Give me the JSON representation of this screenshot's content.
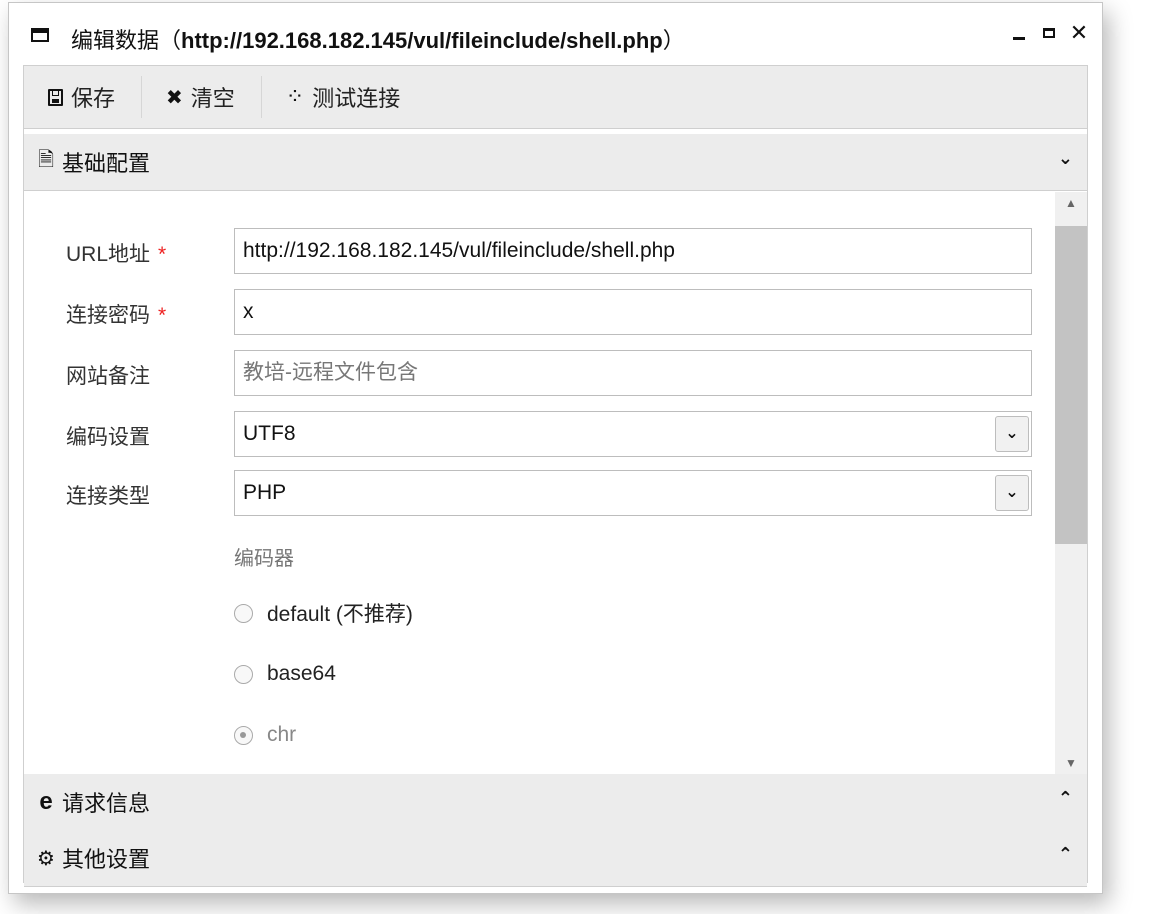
{
  "window": {
    "title_prefix": "编辑数据（",
    "title_url": "http://192.168.182.145/vul/fileinclude/shell.php",
    "title_suffix": "）",
    "controls": {
      "minimize": "minimize-icon",
      "maximize": "maximize-icon",
      "close": "close-icon"
    }
  },
  "toolbar": {
    "save_label": "保存",
    "clear_label": "清空",
    "test_label": "测试连接"
  },
  "panels": {
    "basic": {
      "label": "基础配置",
      "icon": "file-icon",
      "state": "expanded"
    },
    "request": {
      "label": "请求信息",
      "icon": "ie-icon",
      "state": "collapsed"
    },
    "other": {
      "label": "其他设置",
      "icon": "gears-icon",
      "state": "collapsed"
    }
  },
  "form": {
    "url": {
      "label": "URL地址",
      "required": "*",
      "value": "http://192.168.182.145/vul/fileinclude/shell.php"
    },
    "password": {
      "label": "连接密码",
      "required": "*",
      "value": "x"
    },
    "note": {
      "label": "网站备注",
      "value": "",
      "placeholder": "教培-远程文件包含"
    },
    "encoding": {
      "label": "编码设置",
      "value": "UTF8"
    },
    "type": {
      "label": "连接类型",
      "value": "PHP"
    },
    "encoder": {
      "title": "编码器",
      "options": [
        {
          "label": "default (不推荐)",
          "checked": false,
          "disabled": false
        },
        {
          "label": "base64",
          "checked": false,
          "disabled": false
        },
        {
          "label": "chr",
          "checked": true,
          "disabled": true
        }
      ]
    }
  },
  "colors": {
    "required": "#ee2222",
    "panel_bg": "#ececec",
    "border": "#cfcfcf"
  }
}
